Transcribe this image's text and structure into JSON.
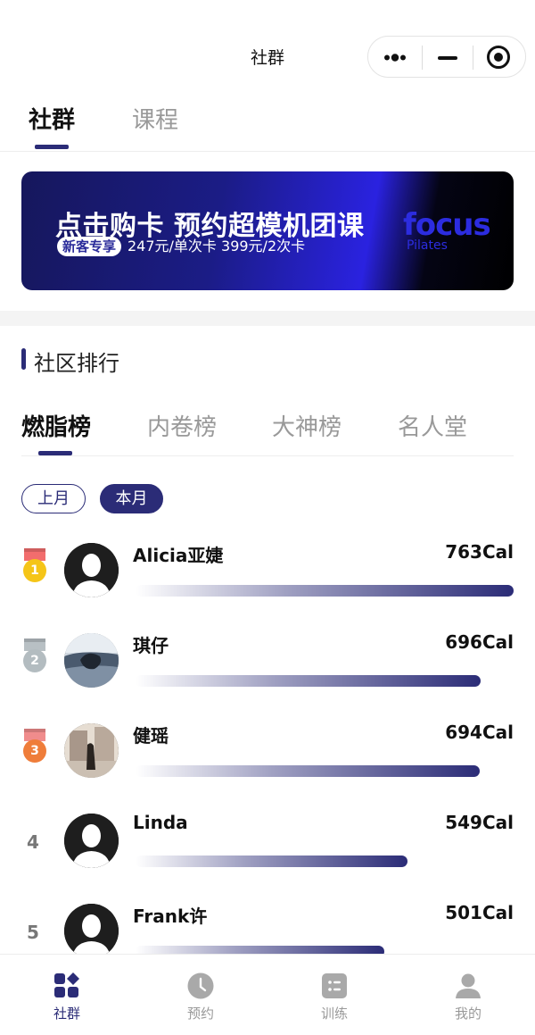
{
  "header": {
    "title": "社群"
  },
  "main_tabs": [
    {
      "label": "社群"
    },
    {
      "label": "课程"
    }
  ],
  "banner": {
    "headline": "点击购卡 预约超模机团课",
    "tag": "新客专享",
    "prices": "247元/单次卡 399元/2次卡",
    "logo": "focus",
    "logo_sub": "Pilates"
  },
  "section": {
    "title": "社区排行"
  },
  "rank_tabs": [
    {
      "label": "燃脂榜"
    },
    {
      "label": "内卷榜"
    },
    {
      "label": "大神榜"
    },
    {
      "label": "名人堂"
    }
  ],
  "period": {
    "last_month": "上月",
    "this_month": "本月",
    "selected": "本月"
  },
  "leaderboard": [
    {
      "rank": "1",
      "name": "Alicia亚婕",
      "cal": "763Cal",
      "medal": "gold",
      "avatar": "default",
      "progress": 1.0
    },
    {
      "rank": "2",
      "name": "琪仔",
      "cal": "696Cal",
      "medal": "silver",
      "avatar": "photo-sea",
      "progress": 0.912
    },
    {
      "rank": "3",
      "name": "健瑶",
      "cal": "694Cal",
      "medal": "bronze",
      "avatar": "photo-street",
      "progress": 0.91
    },
    {
      "rank": "4",
      "name": "Linda",
      "cal": "549Cal",
      "medal": "",
      "avatar": "default",
      "progress": 0.72
    },
    {
      "rank": "5",
      "name": "Frank许",
      "cal": "501Cal",
      "medal": "",
      "avatar": "default",
      "progress": 0.657
    }
  ],
  "tabbar": [
    {
      "label": "社群",
      "icon": "community-icon",
      "active": true
    },
    {
      "label": "预约",
      "icon": "clock-icon",
      "active": false
    },
    {
      "label": "训练",
      "icon": "training-icon",
      "active": false
    },
    {
      "label": "我的",
      "icon": "profile-icon",
      "active": false
    }
  ],
  "colors": {
    "accent": "#2b2c77",
    "gold": "#f5c518",
    "silver": "#b3bcc0",
    "bronze": "#ef7d3a"
  }
}
